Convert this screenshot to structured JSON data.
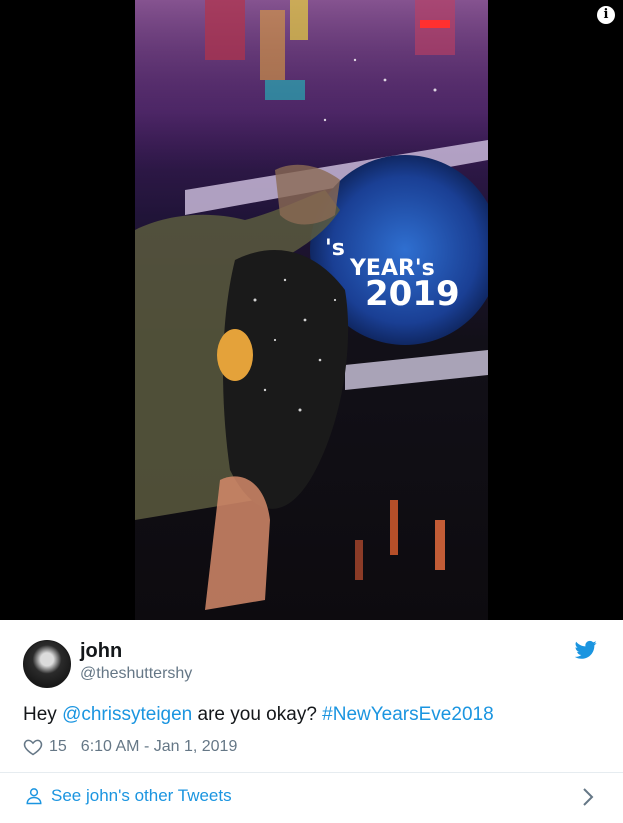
{
  "tweet": {
    "name": "john",
    "handle": "@theshuttershy",
    "text_prefix": "Hey ",
    "mention": "@chrissyteigen",
    "text_middle": " are you okay? ",
    "hashtag": "#NewYearsEve2018",
    "likes": "15",
    "timestamp": "6:10 AM - Jan 1, 2019",
    "see_more": "See john's other Tweets"
  },
  "video": {
    "sign_line1": "'s",
    "sign_line2": "YEAR's",
    "sign_year": "2019"
  },
  "icons": {
    "info": "info-icon",
    "bird": "twitter-bird-icon",
    "heart": "heart-icon",
    "person": "person-icon",
    "chevron": "chevron-right-icon"
  },
  "colors": {
    "link": "#1b95e0",
    "muted": "#657786",
    "text": "#14171a"
  }
}
